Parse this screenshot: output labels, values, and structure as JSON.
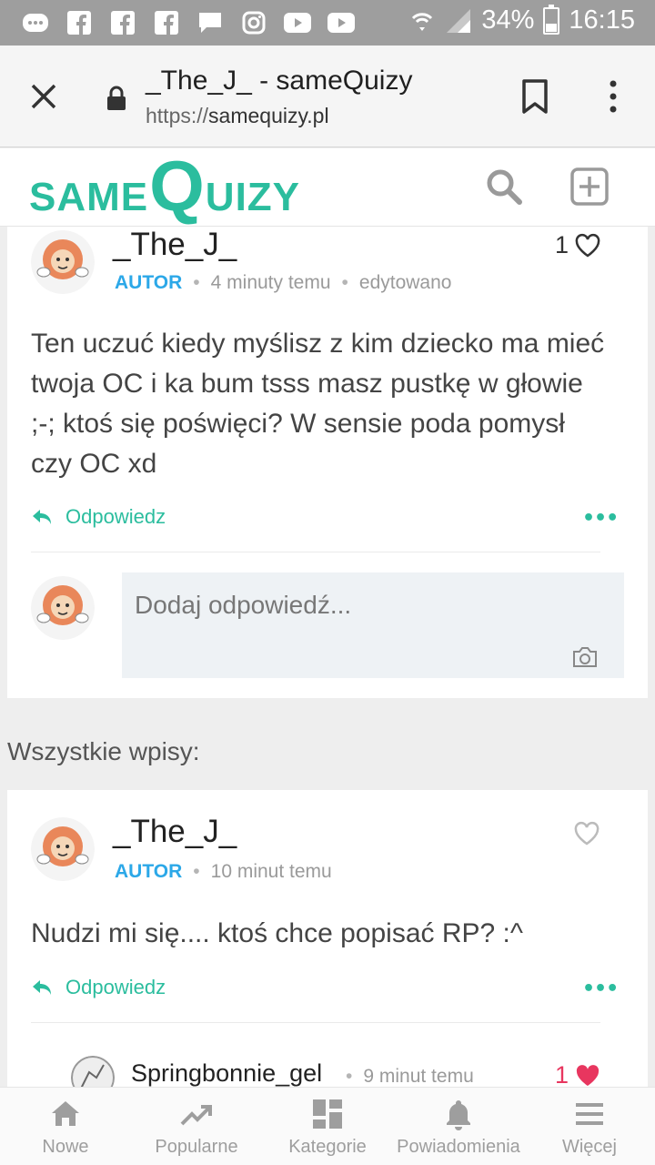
{
  "status_bar": {
    "battery": "34%",
    "time": "16:15",
    "battery_level": 0.34
  },
  "browser": {
    "title": "_The_J_ - sameQuizy",
    "url_scheme": "https://",
    "url_host": "samequizy.pl"
  },
  "site": {
    "logo_part1": "SAME",
    "logo_q": "Q",
    "logo_part2": "UIZY",
    "brand_color": "#2bbd9e"
  },
  "post1": {
    "author": "_The_J_",
    "role": "AUTOR",
    "time": "4 minuty temu",
    "edited": "edytowano",
    "likes": "1",
    "text": "Ten uczuć kiedy myślisz z kim dziecko ma mieć twoja OC i ka bum tsss masz pustkę w głowie ;-; ktoś się poświęci? W sensie poda pomysł czy OC xd",
    "reply_label": "Odpowiedz",
    "more_label": "•••",
    "reply_placeholder": "Dodaj odpowiedź..."
  },
  "section": {
    "title": "Wszystkie wpisy:"
  },
  "post2": {
    "author": "_The_J_",
    "role": "AUTOR",
    "time": "10 minut temu",
    "text": "Nudzi mi się.... ktoś chce popisać RP? :^",
    "reply_label": "Odpowiedz",
    "more_label": "•••"
  },
  "reply_preview": {
    "author": "Springbonnie_gel",
    "time": "9 minut temu",
    "likes": "1"
  },
  "bottom_nav": {
    "items": [
      {
        "label": "Nowe",
        "icon": "home-icon"
      },
      {
        "label": "Popularne",
        "icon": "trending-icon"
      },
      {
        "label": "Kategorie",
        "icon": "grid-icon"
      },
      {
        "label": "Powiadomienia",
        "icon": "bell-icon"
      },
      {
        "label": "Więcej",
        "icon": "menu-icon"
      }
    ]
  }
}
